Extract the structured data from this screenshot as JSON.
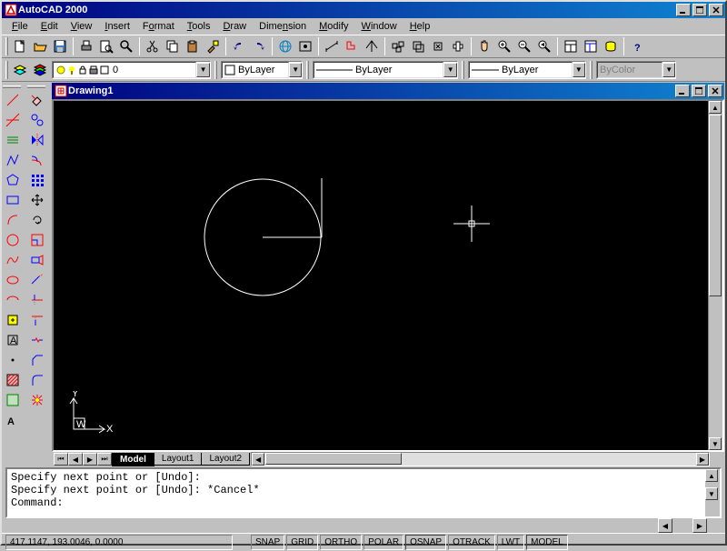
{
  "app": {
    "title": "AutoCAD 2000"
  },
  "menu": {
    "file": "File",
    "edit": "Edit",
    "view": "View",
    "insert": "Insert",
    "format": "Format",
    "tools": "Tools",
    "draw": "Draw",
    "dimension": "Dimension",
    "modify": "Modify",
    "window": "Window",
    "help": "Help"
  },
  "layer": {
    "current": "0"
  },
  "color": {
    "label": "ByLayer"
  },
  "linetype": {
    "label": "ByLayer"
  },
  "lineweight": {
    "label": "ByLayer"
  },
  "plotstyle": {
    "label": "ByColor"
  },
  "drawing": {
    "title": "Drawing1"
  },
  "tabs": {
    "model": "Model",
    "layout1": "Layout1",
    "layout2": "Layout2"
  },
  "command": {
    "line1": "Specify next point or [Undo]:",
    "line2": "Specify next point or [Undo]: *Cancel*",
    "prompt": "Command:"
  },
  "status": {
    "coords": "417.1147, 193.0046, 0.0000",
    "snap": "SNAP",
    "grid": "GRID",
    "ortho": "ORTHO",
    "polar": "POLAR",
    "osnap": "OSNAP",
    "otrack": "OTRACK",
    "lwt": "LWT",
    "model": "MODEL"
  }
}
